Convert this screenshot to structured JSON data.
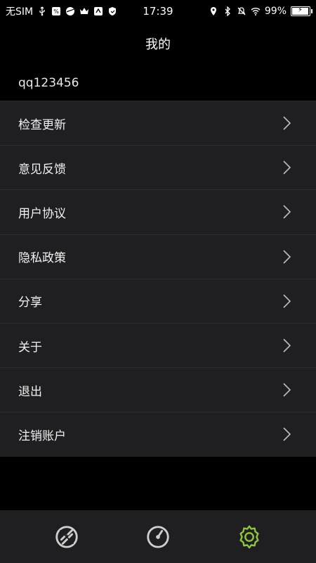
{
  "status_bar": {
    "carrier": "无SIM",
    "time": "17:39",
    "battery": "99%",
    "battery_level": 0.99
  },
  "header": {
    "title": "我的"
  },
  "account": {
    "username": "qq123456"
  },
  "menu": {
    "items": [
      {
        "label": "检查更新"
      },
      {
        "label": "意见反馈"
      },
      {
        "label": "用户协议"
      },
      {
        "label": "隐私政策"
      },
      {
        "label": "分享"
      },
      {
        "label": "关于"
      },
      {
        "label": "退出"
      },
      {
        "label": "注销账户"
      }
    ]
  },
  "bottom_nav": {
    "items": [
      {
        "icon": "link-off-icon",
        "active": false
      },
      {
        "icon": "gauge-icon",
        "active": false
      },
      {
        "icon": "gear-icon",
        "active": true
      }
    ],
    "active_color": "#8ec63f",
    "inactive_color": "#cfcfcf"
  }
}
